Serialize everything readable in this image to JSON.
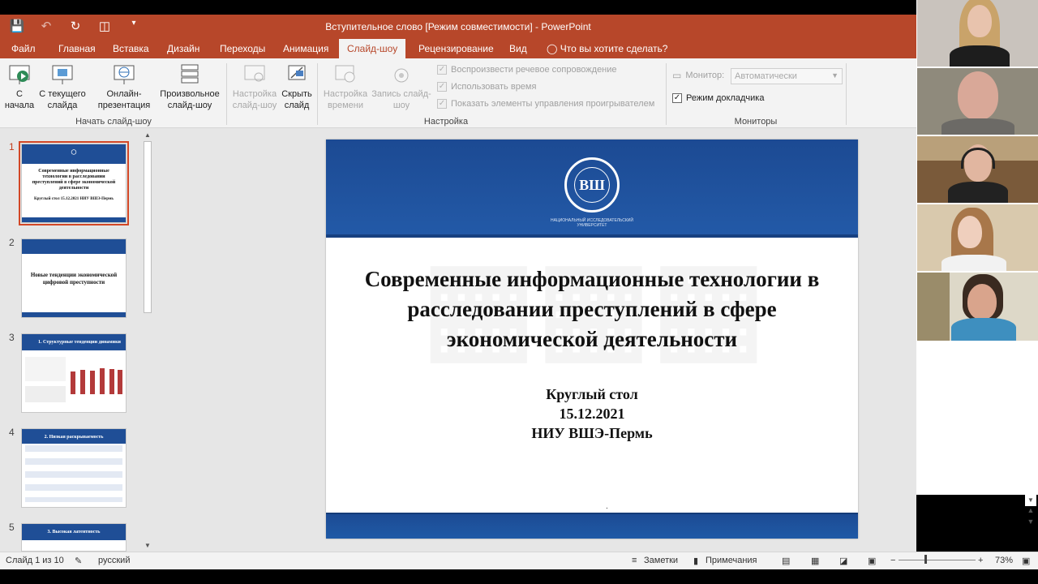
{
  "window": {
    "title": "Вступительное слово [Режим совместимости] - PowerPoint"
  },
  "qat": {
    "save": "save-icon",
    "undo": "undo-icon",
    "redo": "redo-icon",
    "present": "present-icon",
    "customize": "customize-icon"
  },
  "tabs": [
    {
      "label": "Файл"
    },
    {
      "label": "Главная"
    },
    {
      "label": "Вставка"
    },
    {
      "label": "Дизайн"
    },
    {
      "label": "Переходы"
    },
    {
      "label": "Анимация"
    },
    {
      "label": "Слайд-шоу"
    },
    {
      "label": "Рецензирование"
    },
    {
      "label": "Вид"
    },
    {
      "label": "Что вы хотите сделать?"
    }
  ],
  "ribbon": {
    "from_start": "С\nначала",
    "from_current": "С текущего\nслайда",
    "online": "Онлайн-\nпрезентация",
    "custom": "Произвольное\nслайд-шоу",
    "group_start": "Начать слайд-шоу",
    "setup": "Настройка\nслайд-шоу",
    "hide": "Скрыть\nслайд",
    "rehearse": "Настройка\nвремени",
    "record": "Запись слайд-\nшоу",
    "group_setup": "Настройка",
    "chk_narration": "Воспроизвести речевое сопровождение",
    "chk_timings": "Использовать время",
    "chk_controls": "Показать элементы управления проигрывателем",
    "monitor_label": "Монитор:",
    "monitor_value": "Автоматически",
    "presenter_view": "Режим докладчика",
    "group_monitors": "Мониторы"
  },
  "thumbnails": [
    {
      "num": "1",
      "title": "Современные информационные технологии в расследовании преступлений в сфере экономической деятельности",
      "sub": "Круглый стол 15.12.2021 НИУ ВШЭ-Пермь"
    },
    {
      "num": "2",
      "title": "Новые тенденции экономической цифровой преступности"
    },
    {
      "num": "3",
      "title": "1. Структурные тенденции динамики"
    },
    {
      "num": "4",
      "title": "2. Низкая раскрываемость"
    },
    {
      "num": "5",
      "title": "3. Высокая латентность"
    }
  ],
  "slide": {
    "title": "Современные информационные технологии в расследовании преступлений в сфере экономической деятельности",
    "line1": "Круглый стол",
    "line2": "15.12.2021",
    "line3": "НИУ ВШЭ-Пермь",
    "dot": ".",
    "logo_letter": "ВШ",
    "logo_caption": "НАЦИОНАЛЬНЫЙ ИССЛЕДОВАТЕЛЬСКИЙ УНИВЕРСИТЕТ"
  },
  "status": {
    "slide_info": "Слайд 1 из 10",
    "language": "русский",
    "notes": "Заметки",
    "comments": "Примечания",
    "zoom": "73%"
  },
  "colors": {
    "accent": "#b7472a",
    "slide_blue": "#1f4e96"
  }
}
